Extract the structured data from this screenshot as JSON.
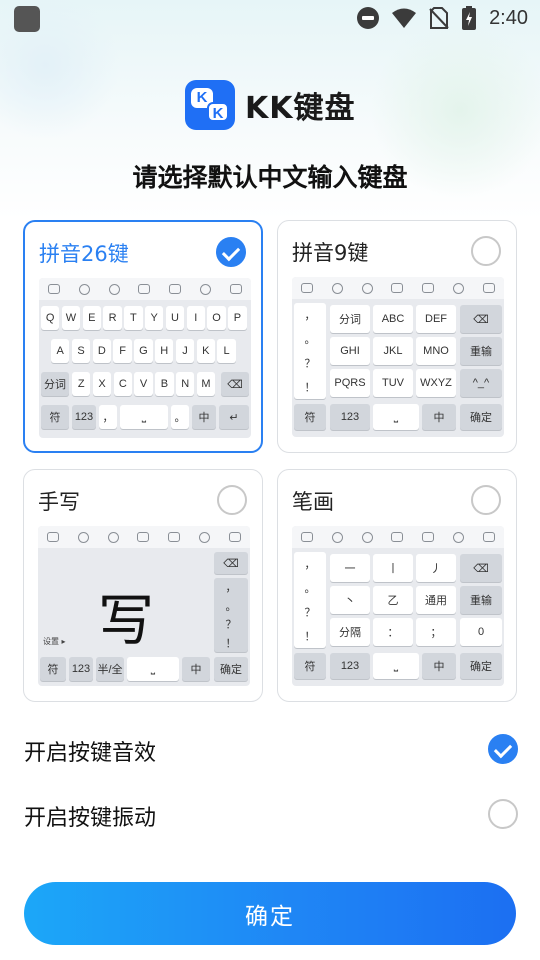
{
  "status_bar": {
    "time": "2:40"
  },
  "logo": {
    "mark_left": "K",
    "mark_right": "K",
    "text": "KK键盘"
  },
  "title": "请选择默认中文输入键盘",
  "cards": [
    {
      "title": "拼音26键",
      "selected": true
    },
    {
      "title": "拼音9键",
      "selected": false
    },
    {
      "title": "手写",
      "selected": false
    },
    {
      "title": "笔画",
      "selected": false
    }
  ],
  "qwerty": {
    "row1": [
      "Q",
      "W",
      "E",
      "R",
      "T",
      "Y",
      "U",
      "I",
      "O",
      "P"
    ],
    "row2": [
      "A",
      "S",
      "D",
      "F",
      "G",
      "H",
      "J",
      "K",
      "L"
    ],
    "row3": [
      "分词",
      "Z",
      "X",
      "C",
      "V",
      "B",
      "N",
      "M"
    ],
    "row4": [
      "符",
      "123",
      "，",
      "。",
      "中"
    ]
  },
  "nine": {
    "col": [
      "，",
      "。",
      "？",
      "！"
    ],
    "keys": [
      "分词",
      "ABC",
      "DEF",
      "GHI",
      "JKL",
      "MNO",
      "PQRS",
      "TUV",
      "WXYZ"
    ],
    "right": [
      "重输",
      "^_^",
      "确定"
    ],
    "bottom": [
      "符",
      "123",
      "中"
    ]
  },
  "handwriting": {
    "char": "写",
    "setting": "设置 ▸",
    "right": [
      "，",
      "。",
      "？",
      "！"
    ],
    "bottom": [
      "符",
      "123",
      "半/全",
      "中",
      "确定"
    ]
  },
  "stroke": {
    "col": [
      "，",
      "。",
      "？",
      "！"
    ],
    "keys": [
      "一",
      "丨",
      "丿",
      "丶",
      "乙",
      "通用",
      "分隔",
      "：",
      "；"
    ],
    "right": [
      "重输",
      "0"
    ],
    "bottom": [
      "符",
      "123",
      "中",
      "确定"
    ]
  },
  "options": [
    {
      "label": "开启按键音效",
      "checked": true
    },
    {
      "label": "开启按键振动",
      "checked": false
    }
  ],
  "confirm": "确定",
  "colors": {
    "accent": "#2a80f2",
    "button_start": "#1ca7f8",
    "button_end": "#1c6ff2"
  }
}
